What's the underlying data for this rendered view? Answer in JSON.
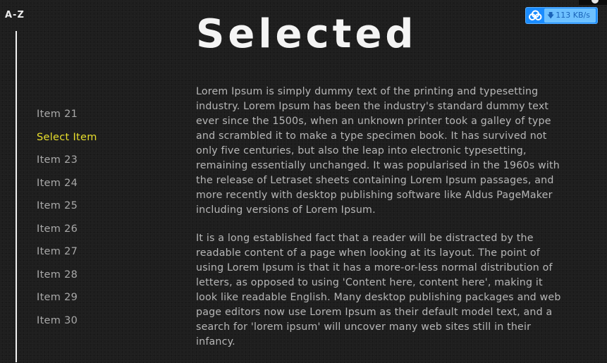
{
  "sidebar": {
    "heading": "A-Z",
    "items": [
      {
        "label": "Item 21",
        "active": false
      },
      {
        "label": "Select Item",
        "active": true
      },
      {
        "label": "Item 23",
        "active": false
      },
      {
        "label": "Item 24",
        "active": false
      },
      {
        "label": "Item 25",
        "active": false
      },
      {
        "label": "Item 26",
        "active": false
      },
      {
        "label": "Item 27",
        "active": false
      },
      {
        "label": "Item 28",
        "active": false
      },
      {
        "label": "Item 29",
        "active": false
      },
      {
        "label": "Item 30",
        "active": false
      }
    ]
  },
  "main": {
    "title": "Selected",
    "paragraphs": [
      "Lorem Ipsum is simply dummy text of the printing and typesetting industry. Lorem Ipsum has been the industry's standard dummy text ever since the 1500s, when an unknown printer took a galley of type and scrambled it to make a type specimen book. It has survived not only five centuries, but also the leap into electronic typesetting, remaining essentially unchanged. It was popularised in the 1960s with the release of Letraset sheets containing Lorem Ipsum passages, and more recently with desktop publishing software like Aldus PageMaker including versions of Lorem Ipsum.",
      "It is a long established fact that a reader will be distracted by the readable content of a page when looking at its layout. The point of using Lorem Ipsum is that it has a more-or-less normal distribution of letters, as opposed to using 'Content here, content here', making it look like readable English. Many desktop publishing packages and web page editors now use Lorem Ipsum as their default model text, and a search for 'lorem ipsum' will uncover many web sites still in their infancy."
    ]
  },
  "speed_widget": {
    "speed": "113 KB/s",
    "icon": "cloud-icon",
    "arrow_icon": "download-arrow-icon"
  },
  "colors": {
    "background": "#1e1e1e",
    "active_item": "#e9df2c",
    "nav_text": "#a9a9a9",
    "title": "#f4f4f4",
    "widget_blue": "#1a8cff"
  }
}
